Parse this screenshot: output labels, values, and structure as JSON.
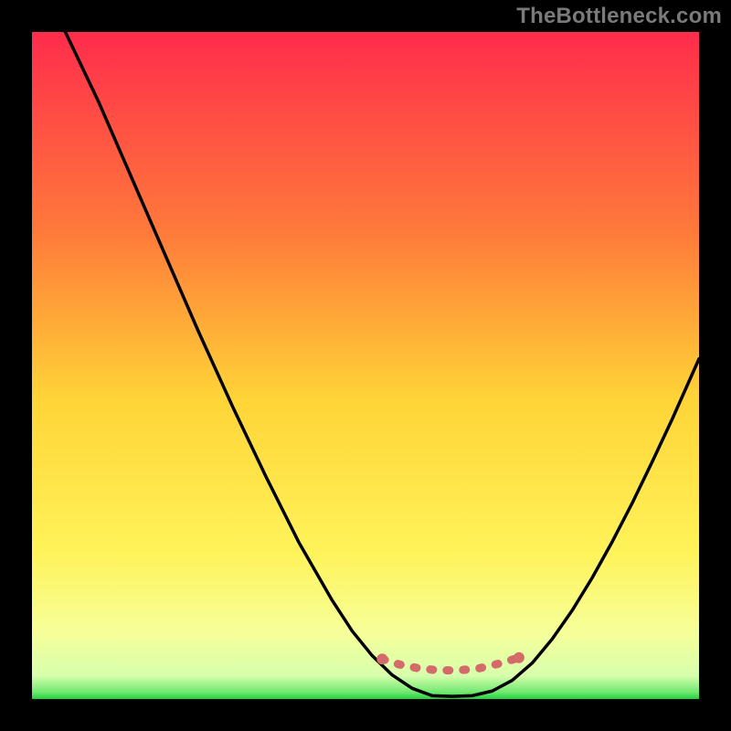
{
  "watermark": "TheBottleneck.com",
  "chart_data": {
    "type": "line",
    "title": "",
    "xlabel": "",
    "ylabel": "",
    "xlim": [
      0,
      100
    ],
    "ylim": [
      0,
      100
    ],
    "grid": false,
    "legend": false,
    "background_gradient": {
      "stops": [
        {
          "offset": 0.0,
          "color": "#ff2c4c"
        },
        {
          "offset": 0.3,
          "color": "#ff7a3a"
        },
        {
          "offset": 0.55,
          "color": "#ffd437"
        },
        {
          "offset": 0.78,
          "color": "#fff35a"
        },
        {
          "offset": 0.9,
          "color": "#f6ff99"
        },
        {
          "offset": 0.965,
          "color": "#d8ffad"
        },
        {
          "offset": 0.99,
          "color": "#6fe86f"
        },
        {
          "offset": 1.0,
          "color": "#1fd13c"
        }
      ]
    },
    "series": [
      {
        "name": "main-curve",
        "color": "#000000",
        "points": [
          {
            "x": 5.0,
            "y": 100.0
          },
          {
            "x": 10.0,
            "y": 89.5
          },
          {
            "x": 15.0,
            "y": 78.0
          },
          {
            "x": 20.0,
            "y": 66.5
          },
          {
            "x": 25.0,
            "y": 55.0
          },
          {
            "x": 30.0,
            "y": 44.0
          },
          {
            "x": 35.0,
            "y": 33.5
          },
          {
            "x": 40.0,
            "y": 23.5
          },
          {
            "x": 45.0,
            "y": 14.8
          },
          {
            "x": 48.0,
            "y": 10.2
          },
          {
            "x": 51.0,
            "y": 6.5
          },
          {
            "x": 54.0,
            "y": 3.6
          },
          {
            "x": 57.0,
            "y": 1.6
          },
          {
            "x": 60.0,
            "y": 0.5
          },
          {
            "x": 63.0,
            "y": 0.4
          },
          {
            "x": 66.0,
            "y": 0.5
          },
          {
            "x": 69.0,
            "y": 1.2
          },
          {
            "x": 72.0,
            "y": 2.8
          },
          {
            "x": 75.0,
            "y": 5.4
          },
          {
            "x": 78.0,
            "y": 9.0
          },
          {
            "x": 81.0,
            "y": 13.3
          },
          {
            "x": 84.0,
            "y": 18.2
          },
          {
            "x": 87.0,
            "y": 23.6
          },
          {
            "x": 90.0,
            "y": 29.4
          },
          {
            "x": 93.0,
            "y": 35.6
          },
          {
            "x": 96.0,
            "y": 42.0
          },
          {
            "x": 100.0,
            "y": 51.0
          }
        ]
      }
    ],
    "markers": [
      {
        "name": "bottom-dashed-accent",
        "color": "#d46a6a",
        "points": [
          {
            "x": 52.5,
            "y": 6.0
          },
          {
            "x": 55.0,
            "y": 5.2
          },
          {
            "x": 58.0,
            "y": 4.6
          },
          {
            "x": 61.0,
            "y": 4.3
          },
          {
            "x": 64.0,
            "y": 4.3
          },
          {
            "x": 67.0,
            "y": 4.6
          },
          {
            "x": 70.0,
            "y": 5.3
          },
          {
            "x": 73.0,
            "y": 6.2
          }
        ]
      }
    ]
  }
}
